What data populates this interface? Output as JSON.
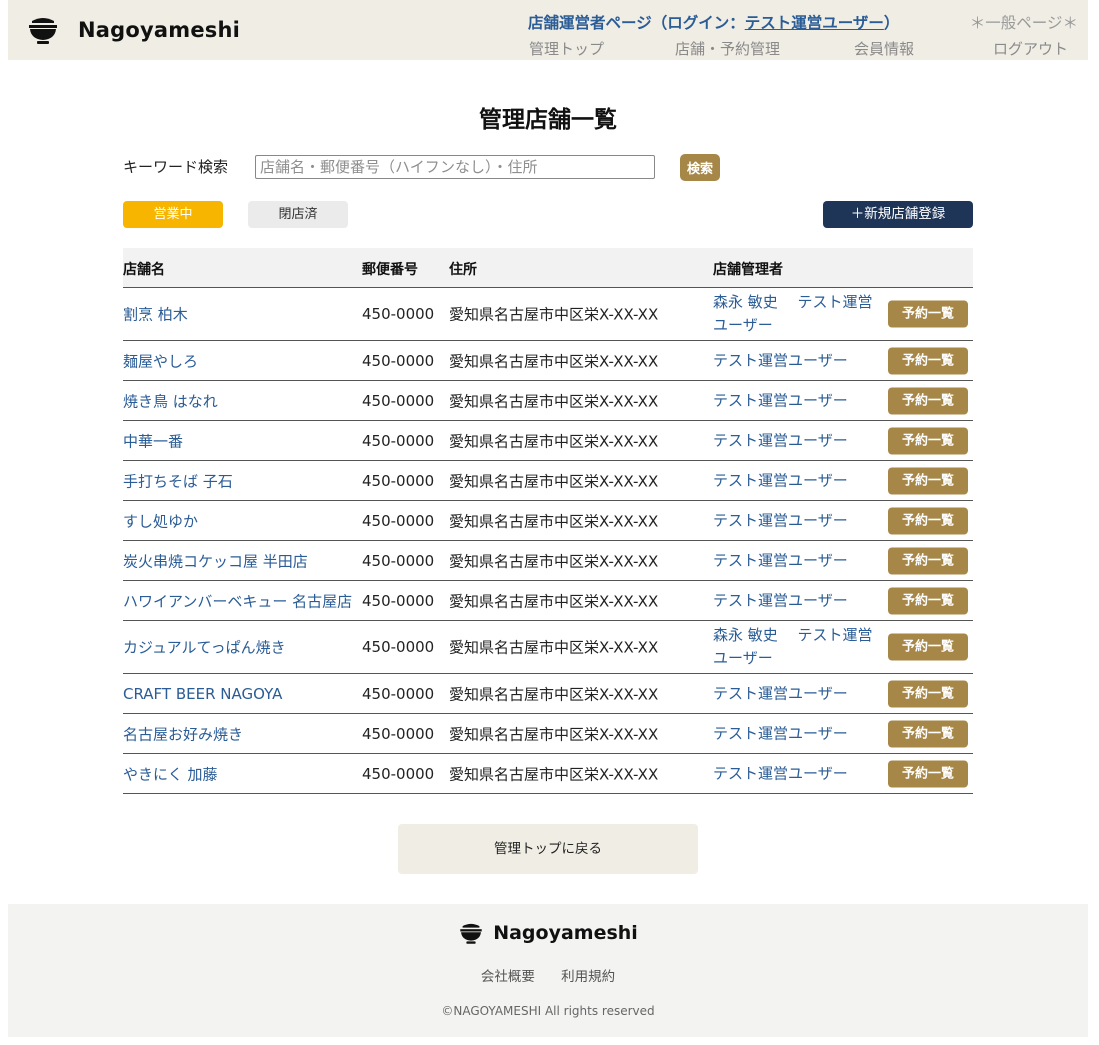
{
  "header": {
    "brand": "Nagoyameshi",
    "title_prefix": "店舗運営者ページ（ログイン：",
    "title_user": "テスト運営ユーザー",
    "title_suffix": "）",
    "general_page": "＊一般ページ＊",
    "nav": [
      "管理トップ",
      "店舗・予約管理",
      "会員情報",
      "ログアウト"
    ]
  },
  "page": {
    "title": "管理店舗一覧",
    "search_label": "キーワード検索",
    "search_placeholder": "店舗名・郵便番号（ハイフンなし）・住所",
    "search_button": "検索",
    "tab_open": "営業中",
    "tab_closed": "閉店済",
    "new_button": "＋新規店舗登録",
    "back_button": "管理トップに戻る"
  },
  "table": {
    "headers": [
      "店舗名",
      "郵便番号",
      "住所",
      "店舗管理者"
    ],
    "action_label": "予約一覧",
    "rows": [
      {
        "name": "割烹 柏木",
        "zip": "450-0000",
        "address": "愛知県名古屋市中区栄X-XX-XX",
        "managers": "森永 敏史　 テスト運営ユーザー",
        "tall": true
      },
      {
        "name": "麺屋やしろ",
        "zip": "450-0000",
        "address": "愛知県名古屋市中区栄X-XX-XX",
        "managers": "テスト運営ユーザー",
        "tall": false
      },
      {
        "name": "焼き鳥 はなれ",
        "zip": "450-0000",
        "address": "愛知県名古屋市中区栄X-XX-XX",
        "managers": "テスト運営ユーザー",
        "tall": false
      },
      {
        "name": "中華一番",
        "zip": "450-0000",
        "address": "愛知県名古屋市中区栄X-XX-XX",
        "managers": "テスト運営ユーザー",
        "tall": false
      },
      {
        "name": "手打ちそば 子石",
        "zip": "450-0000",
        "address": "愛知県名古屋市中区栄X-XX-XX",
        "managers": "テスト運営ユーザー",
        "tall": false
      },
      {
        "name": "すし処ゆか",
        "zip": "450-0000",
        "address": "愛知県名古屋市中区栄X-XX-XX",
        "managers": "テスト運営ユーザー",
        "tall": false
      },
      {
        "name": "炭火串焼コケッコ屋 半田店",
        "zip": "450-0000",
        "address": "愛知県名古屋市中区栄X-XX-XX",
        "managers": "テスト運営ユーザー",
        "tall": false
      },
      {
        "name": "ハワイアンバーベキュー 名古屋店",
        "zip": "450-0000",
        "address": "愛知県名古屋市中区栄X-XX-XX",
        "managers": "テスト運営ユーザー",
        "tall": false
      },
      {
        "name": "カジュアルてっぱん焼き",
        "zip": "450-0000",
        "address": "愛知県名古屋市中区栄X-XX-XX",
        "managers": "森永 敏史　 テスト運営ユーザー",
        "tall": true
      },
      {
        "name": "CRAFT BEER NAGOYA",
        "zip": "450-0000",
        "address": "愛知県名古屋市中区栄X-XX-XX",
        "managers": "テスト運営ユーザー",
        "tall": false
      },
      {
        "name": "名古屋お好み焼き",
        "zip": "450-0000",
        "address": "愛知県名古屋市中区栄X-XX-XX",
        "managers": "テスト運営ユーザー",
        "tall": false
      },
      {
        "name": "やきにく 加藤",
        "zip": "450-0000",
        "address": "愛知県名古屋市中区栄X-XX-XX",
        "managers": "テスト運営ユーザー",
        "tall": false
      }
    ]
  },
  "footer": {
    "brand": "Nagoyameshi",
    "links": [
      "会社概要",
      "利用規約"
    ],
    "copyright": "©NAGOYAMESHI All rights reserved"
  },
  "colors": {
    "header_bg": "#f0ede5",
    "link_blue": "#2a5c96",
    "gold": "#a68747",
    "amber": "#f7b500",
    "navy": "#1f3558"
  },
  "icons": {
    "logo": "rice-bowl-icon"
  }
}
